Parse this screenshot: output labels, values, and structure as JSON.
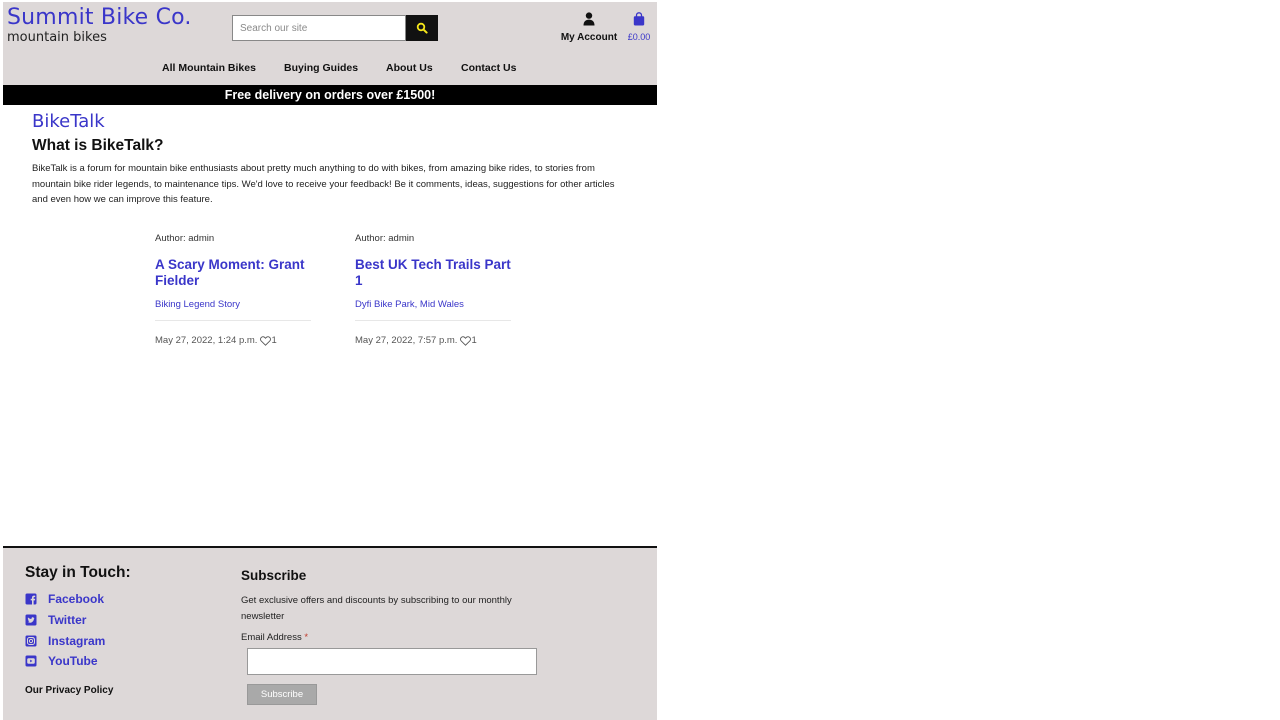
{
  "header": {
    "brand_title": "Summit Bike Co.",
    "brand_subtitle": "mountain bikes",
    "search_placeholder": "Search our site",
    "account_label": "My Account",
    "bag_total": "£0.00"
  },
  "nav": {
    "items": [
      {
        "label": "All Mountain Bikes"
      },
      {
        "label": "Buying Guides"
      },
      {
        "label": "About Us"
      },
      {
        "label": "Contact Us"
      }
    ]
  },
  "banner": {
    "text": "Free delivery on orders over £1500!"
  },
  "main": {
    "section_title": "BikeTalk",
    "intro_heading": "What is BikeTalk?",
    "intro_text": "BikeTalk is a forum for mountain bike enthusiasts about pretty much anything to do with bikes, from amazing bike rides, to stories from mountain bike rider legends, to maintenance tips. We'd love to receive your feedback! Be it comments, ideas, suggestions for other articles and even how we can improve this feature.",
    "posts": [
      {
        "author": "Author: admin",
        "title": "A Scary Moment: Grant Fielder",
        "excerpt": "Biking Legend Story",
        "date": "May 27, 2022, 1:24 p.m.",
        "likes": "1"
      },
      {
        "author": "Author: admin",
        "title": "Best UK Tech Trails Part 1",
        "excerpt": "Dyfi Bike Park, Mid Wales",
        "date": "May 27, 2022, 7:57 p.m.",
        "likes": "1"
      }
    ]
  },
  "footer": {
    "stay_heading": "Stay in Touch:",
    "social": [
      {
        "label": "Facebook",
        "icon": "facebook-icon"
      },
      {
        "label": "Twitter",
        "icon": "twitter-icon"
      },
      {
        "label": "Instagram",
        "icon": "instagram-icon"
      },
      {
        "label": "YouTube",
        "icon": "youtube-icon"
      }
    ],
    "privacy": "Our Privacy Policy",
    "subscribe_heading": "Subscribe",
    "subscribe_text": "Get exclusive offers and discounts by subscribing to our monthly newsletter",
    "email_label": "Email Address",
    "required_mark": "*",
    "email_value": "",
    "subscribe_button": "Subscribe"
  },
  "colors": {
    "brand": "#3a36c9",
    "header_bg": "#ddd8d8",
    "banner_bg": "#000000",
    "search_icon": "#f5e61a"
  }
}
